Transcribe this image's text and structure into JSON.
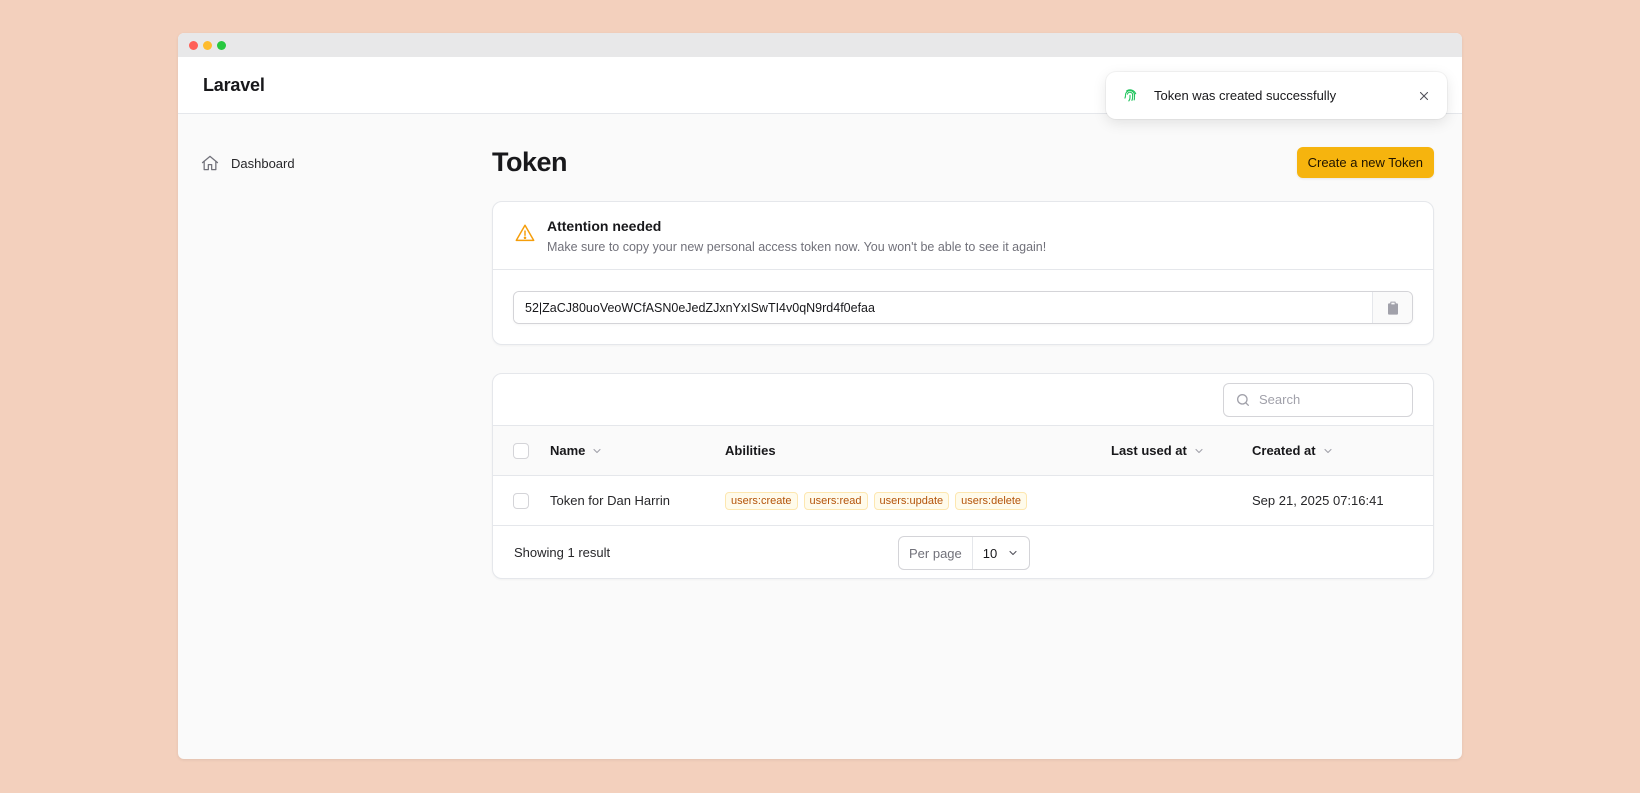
{
  "window": {
    "brand": "Laravel"
  },
  "sidebar": {
    "items": [
      {
        "label": "Dashboard",
        "icon": "home-icon"
      }
    ]
  },
  "header": {
    "title": "Token",
    "create_label": "Create a new Token"
  },
  "attention": {
    "title": "Attention needed",
    "description": "Make sure to copy your new personal access token now. You won't be able to see it again!",
    "token_value": "52|ZaCJ80uoVeoWCfASN0eJedZJxnYxISwTI4v0qN9rd4f0efaa"
  },
  "table": {
    "search_placeholder": "Search",
    "columns": {
      "name": "Name",
      "abilities": "Abilities",
      "last_used": "Last used at",
      "created": "Created at"
    },
    "rows": [
      {
        "name": "Token for Dan Harrin",
        "abilities": [
          "users:create",
          "users:read",
          "users:update",
          "users:delete"
        ],
        "last_used": "",
        "created": "Sep 21, 2025 07:16:41"
      }
    ],
    "footer": {
      "showing": "Showing 1 result",
      "per_page_label": "Per page",
      "per_page_value": "10"
    }
  },
  "toast": {
    "message": "Token was created successfully"
  },
  "colors": {
    "primary": "#f6b40e",
    "success": "#22c55e",
    "warning": "#f59e0b",
    "background": "#f3d0bd"
  }
}
